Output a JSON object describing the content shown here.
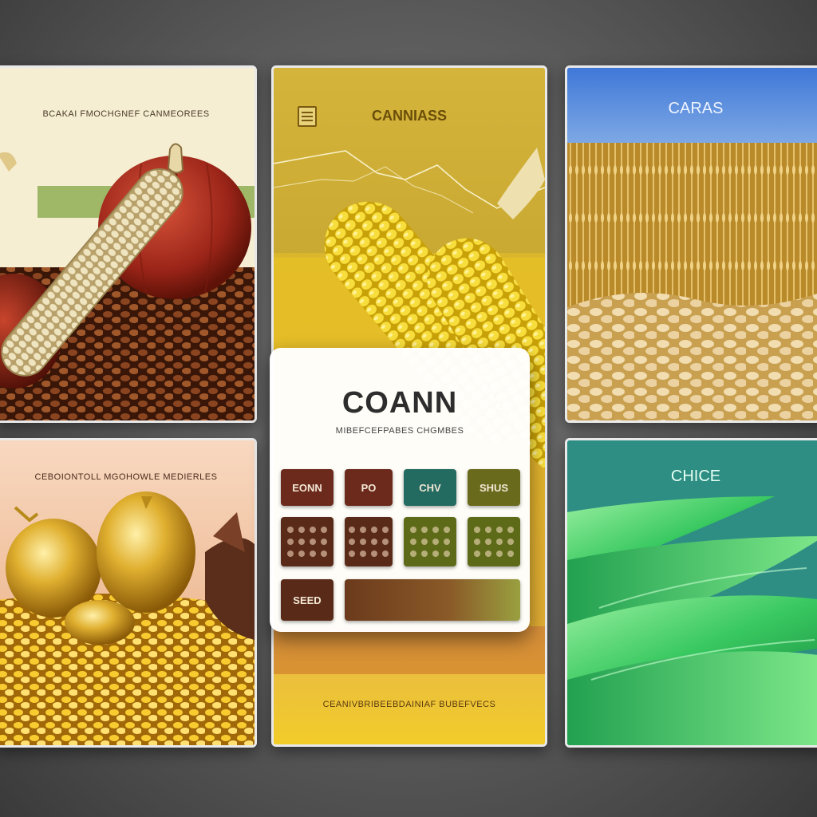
{
  "panels": {
    "top_left": {
      "title": "BCAKAI FMOCHGNEF CANMEOREES"
    },
    "top_middle": {
      "title": "CANNIASS",
      "footer": "CEANIVBRIBEEBDAINIAF BUBEFVECS"
    },
    "top_right": {
      "title": "CARAS"
    },
    "bottom_left": {
      "title": "CEBOIONTOLL MGOHOWLE MEDIERLES"
    },
    "bottom_right": {
      "title": "CHICE"
    }
  },
  "overlay": {
    "title": "COANN",
    "subtitle": "MIBEFCEFPABES CHGMBES",
    "tiles": [
      {
        "label": "EONN",
        "color": "#6b2a1c"
      },
      {
        "label": "PO",
        "color": "#6b2a1c"
      },
      {
        "label": "CHV",
        "color": "#236a60"
      },
      {
        "label": "SHUS",
        "color": "#6a6a1c"
      },
      {
        "label": "",
        "color": "#5a2a18"
      },
      {
        "label": "",
        "color": "#5a2a18"
      },
      {
        "label": "",
        "color": "#5d6a18"
      },
      {
        "label": "",
        "color": "#5d6a18"
      },
      {
        "label": "SEED",
        "color": "#5a2a18"
      },
      {
        "label": "",
        "color": "#6b3a1c"
      }
    ]
  },
  "colors": {
    "background": "#5a5a5a",
    "overlay_card": "#ffffff",
    "accent_gold": "#d9b93a",
    "accent_green": "#2f8f85"
  },
  "icons": {
    "menu": "document-icon"
  }
}
